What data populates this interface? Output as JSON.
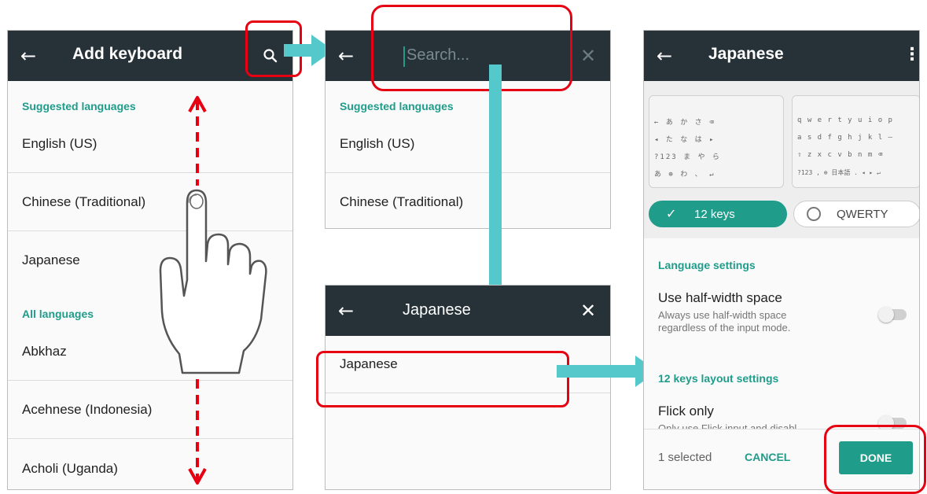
{
  "screen1": {
    "title": "Add keyboard",
    "suggested_header": "Suggested languages",
    "suggested": [
      "English (US)",
      "Chinese (Traditional)",
      "Japanese"
    ],
    "all_header": "All languages",
    "all": [
      "Abkhaz",
      "Acehnese (Indonesia)",
      "Acholi (Uganda)"
    ]
  },
  "screen2": {
    "search_placeholder": "Search...",
    "suggested_header": "Suggested languages",
    "suggested": [
      "English (US)",
      "Chinese (Traditional)"
    ]
  },
  "screen3": {
    "query": "Japanese",
    "result": "Japanese"
  },
  "screen4": {
    "title": "Japanese",
    "layout_options": [
      "12 keys",
      "QWERTY"
    ],
    "selected_layout": "12 keys",
    "lang_settings_header": "Language settings",
    "half_width_title": "Use half-width space",
    "half_width_desc1": "Always use half-width space",
    "half_width_desc2": "regardless of the input mode.",
    "layout_settings_header": "12 keys layout settings",
    "flick_title": "Flick only",
    "flick_desc": "Only use Flick input and disabl",
    "selected_count": "1 selected",
    "cancel_label": "CANCEL",
    "done_label": "DONE",
    "kbd12_rows": [
      "← あ か さ ⌫",
      "◂ た な は ▸",
      "?123 ま や ら",
      "あ ⊕ わ 、 ↵"
    ],
    "kbdq_rows": [
      "q w e r t y u i o p",
      "a s d f g h j k l —",
      "⇧ z x c v b n m ⌫",
      "?123 , ⊕ 日本語 . ◂ ▸ ↵"
    ]
  },
  "colors": {
    "appbar": "#263238",
    "accent": "#1f9c8a",
    "highlight": "#e60012",
    "arrow": "#55c8cb"
  },
  "icons": [
    "back-arrow-icon",
    "search-icon",
    "close-icon",
    "more-vert-icon",
    "check-icon",
    "radio-icon",
    "hand-pointer-icon",
    "scroll-arrow-icon"
  ]
}
